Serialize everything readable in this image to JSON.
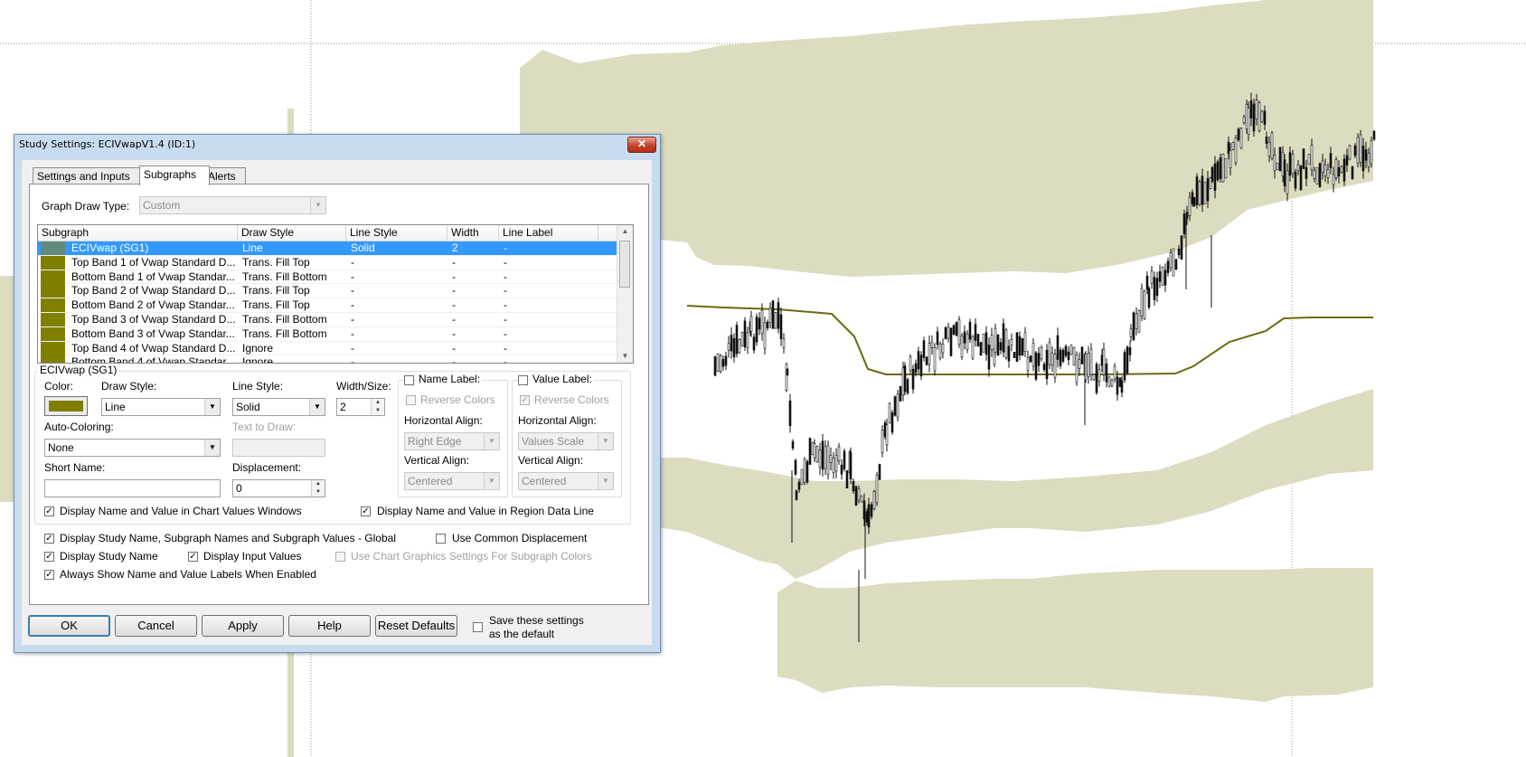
{
  "dialog": {
    "title": "Study Settings: ECIVwapV1.4 (ID:1)",
    "close_glyph": "✕"
  },
  "tabs": [
    {
      "label": "Settings and Inputs",
      "active": false
    },
    {
      "label": "Subgraphs",
      "active": true
    },
    {
      "label": "Alerts",
      "active": false
    }
  ],
  "graph_draw_type": {
    "label": "Graph Draw Type:",
    "value": "Custom"
  },
  "subgraph_table": {
    "columns": [
      "Subgraph",
      "Draw Style",
      "Line Style",
      "Width",
      "Line Label"
    ],
    "rows": [
      {
        "color": "#5f8a7d",
        "name": "ECIVwap (SG1)",
        "draw_style": "Line",
        "line_style": "Solid",
        "width": "2",
        "line_label": "-",
        "selected": true
      },
      {
        "color": "#808000",
        "name": "Top Band 1 of Vwap Standard D...",
        "draw_style": "Trans. Fill Top",
        "line_style": "-",
        "width": "-",
        "line_label": "-"
      },
      {
        "color": "#808000",
        "name": "Bottom Band 1 of Vwap Standar...",
        "draw_style": "Trans. Fill Bottom",
        "line_style": "-",
        "width": "-",
        "line_label": "-"
      },
      {
        "color": "#808000",
        "name": "Top Band 2 of Vwap Standard D...",
        "draw_style": "Trans. Fill Top",
        "line_style": "-",
        "width": "-",
        "line_label": "-"
      },
      {
        "color": "#808000",
        "name": "Bottom Band 2 of Vwap Standar...",
        "draw_style": "Trans. Fill Top",
        "line_style": "-",
        "width": "-",
        "line_label": "-"
      },
      {
        "color": "#808000",
        "name": "Top Band 3 of Vwap Standard D...",
        "draw_style": "Trans. Fill Bottom",
        "line_style": "-",
        "width": "-",
        "line_label": "-"
      },
      {
        "color": "#808000",
        "name": "Bottom Band 3 of Vwap Standar...",
        "draw_style": "Trans. Fill Bottom",
        "line_style": "-",
        "width": "-",
        "line_label": "-"
      },
      {
        "color": "#808000",
        "name": "Top Band 4 of Vwap Standard D...",
        "draw_style": "Ignore",
        "line_style": "-",
        "width": "-",
        "line_label": "-"
      },
      {
        "color": "#808000",
        "name": "Bottom Band 4 of Vwap Standar...",
        "draw_style": "Ignore",
        "line_style": "-",
        "width": "-",
        "line_label": "-"
      }
    ]
  },
  "subgraph_group": {
    "title": "ECIVwap (SG1)",
    "color_label": "Color:",
    "color_value": "#808000",
    "draw_style_label": "Draw Style:",
    "draw_style_value": "Line",
    "line_style_label": "Line Style:",
    "line_style_value": "Solid",
    "width_label": "Width/Size:",
    "width_value": "2",
    "auto_coloring_label": "Auto-Coloring:",
    "auto_coloring_value": "None",
    "text_to_draw_label": "Text to Draw:",
    "short_name_label": "Short Name:",
    "short_name_value": "",
    "displacement_label": "Displacement:",
    "displacement_value": "0",
    "name_label": {
      "checkbox_label": "Name Label:",
      "reverse_colors": "Reverse Colors",
      "h_align_label": "Horizontal Align:",
      "h_align_value": "Right Edge",
      "v_align_label": "Vertical Align:",
      "v_align_value": "Centered"
    },
    "value_label": {
      "checkbox_label": "Value Label:",
      "reverse_colors": "Reverse Colors",
      "h_align_label": "Horizontal Align:",
      "h_align_value": "Values Scale",
      "v_align_label": "Vertical Align:",
      "v_align_value": "Centered"
    },
    "display_in_values_windows": "Display Name and Value in Chart Values Windows",
    "display_in_region_data_line": "Display Name and Value in Region Data Line"
  },
  "global_options": {
    "display_global": "Display Study Name, Subgraph Names and Subgraph Values - Global",
    "use_common_displacement": "Use Common Displacement",
    "display_study_name": "Display Study Name",
    "display_input_values": "Display Input Values",
    "use_chart_graphics": "Use Chart Graphics Settings For Subgraph Colors",
    "always_show_labels": "Always Show Name and Value Labels When Enabled"
  },
  "buttons": {
    "ok": "OK",
    "cancel": "Cancel",
    "apply": "Apply",
    "help": "Help",
    "reset_defaults": "Reset Defaults",
    "save_default_line1": "Save these settings",
    "save_default_line2": "as the default"
  },
  "check_glyph": "✓",
  "colors": {
    "band_fill": "#dcdcc0",
    "vwap_line": "#6b6b10",
    "selection": "#3399ff",
    "swatch_olive": "#808000"
  }
}
